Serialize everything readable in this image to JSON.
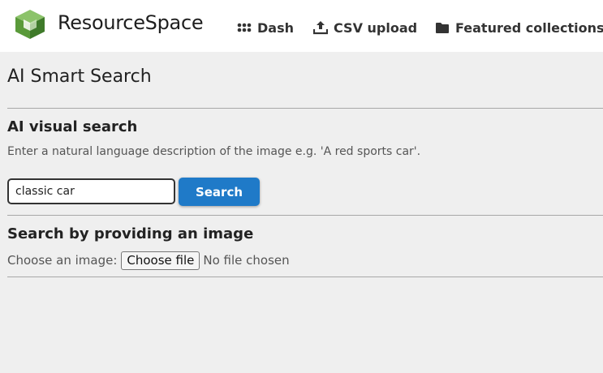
{
  "header": {
    "brand_bold": "Resource",
    "brand_light": "Space",
    "logo_icon": "resourcespace-cube-logo",
    "nav": [
      {
        "label": "Dash",
        "icon": "grid-dots-icon"
      },
      {
        "label": "CSV upload",
        "icon": "upload-icon"
      },
      {
        "label": "Featured collections",
        "icon": "folder-icon"
      }
    ]
  },
  "main": {
    "title": "AI Smart Search",
    "visual_search": {
      "heading": "AI visual search",
      "description": "Enter a natural language description of the image e.g. 'A red sports car'.",
      "input_value": "classic car",
      "button_label": "Search"
    },
    "image_search": {
      "heading": "Search by providing an image",
      "choose_label": "Choose an image:",
      "file_button_label": "Choose file",
      "file_status": "No file chosen"
    }
  },
  "colors": {
    "accent": "#1f7ac8",
    "logo_green": "#6aa84f",
    "background": "#efefef"
  }
}
